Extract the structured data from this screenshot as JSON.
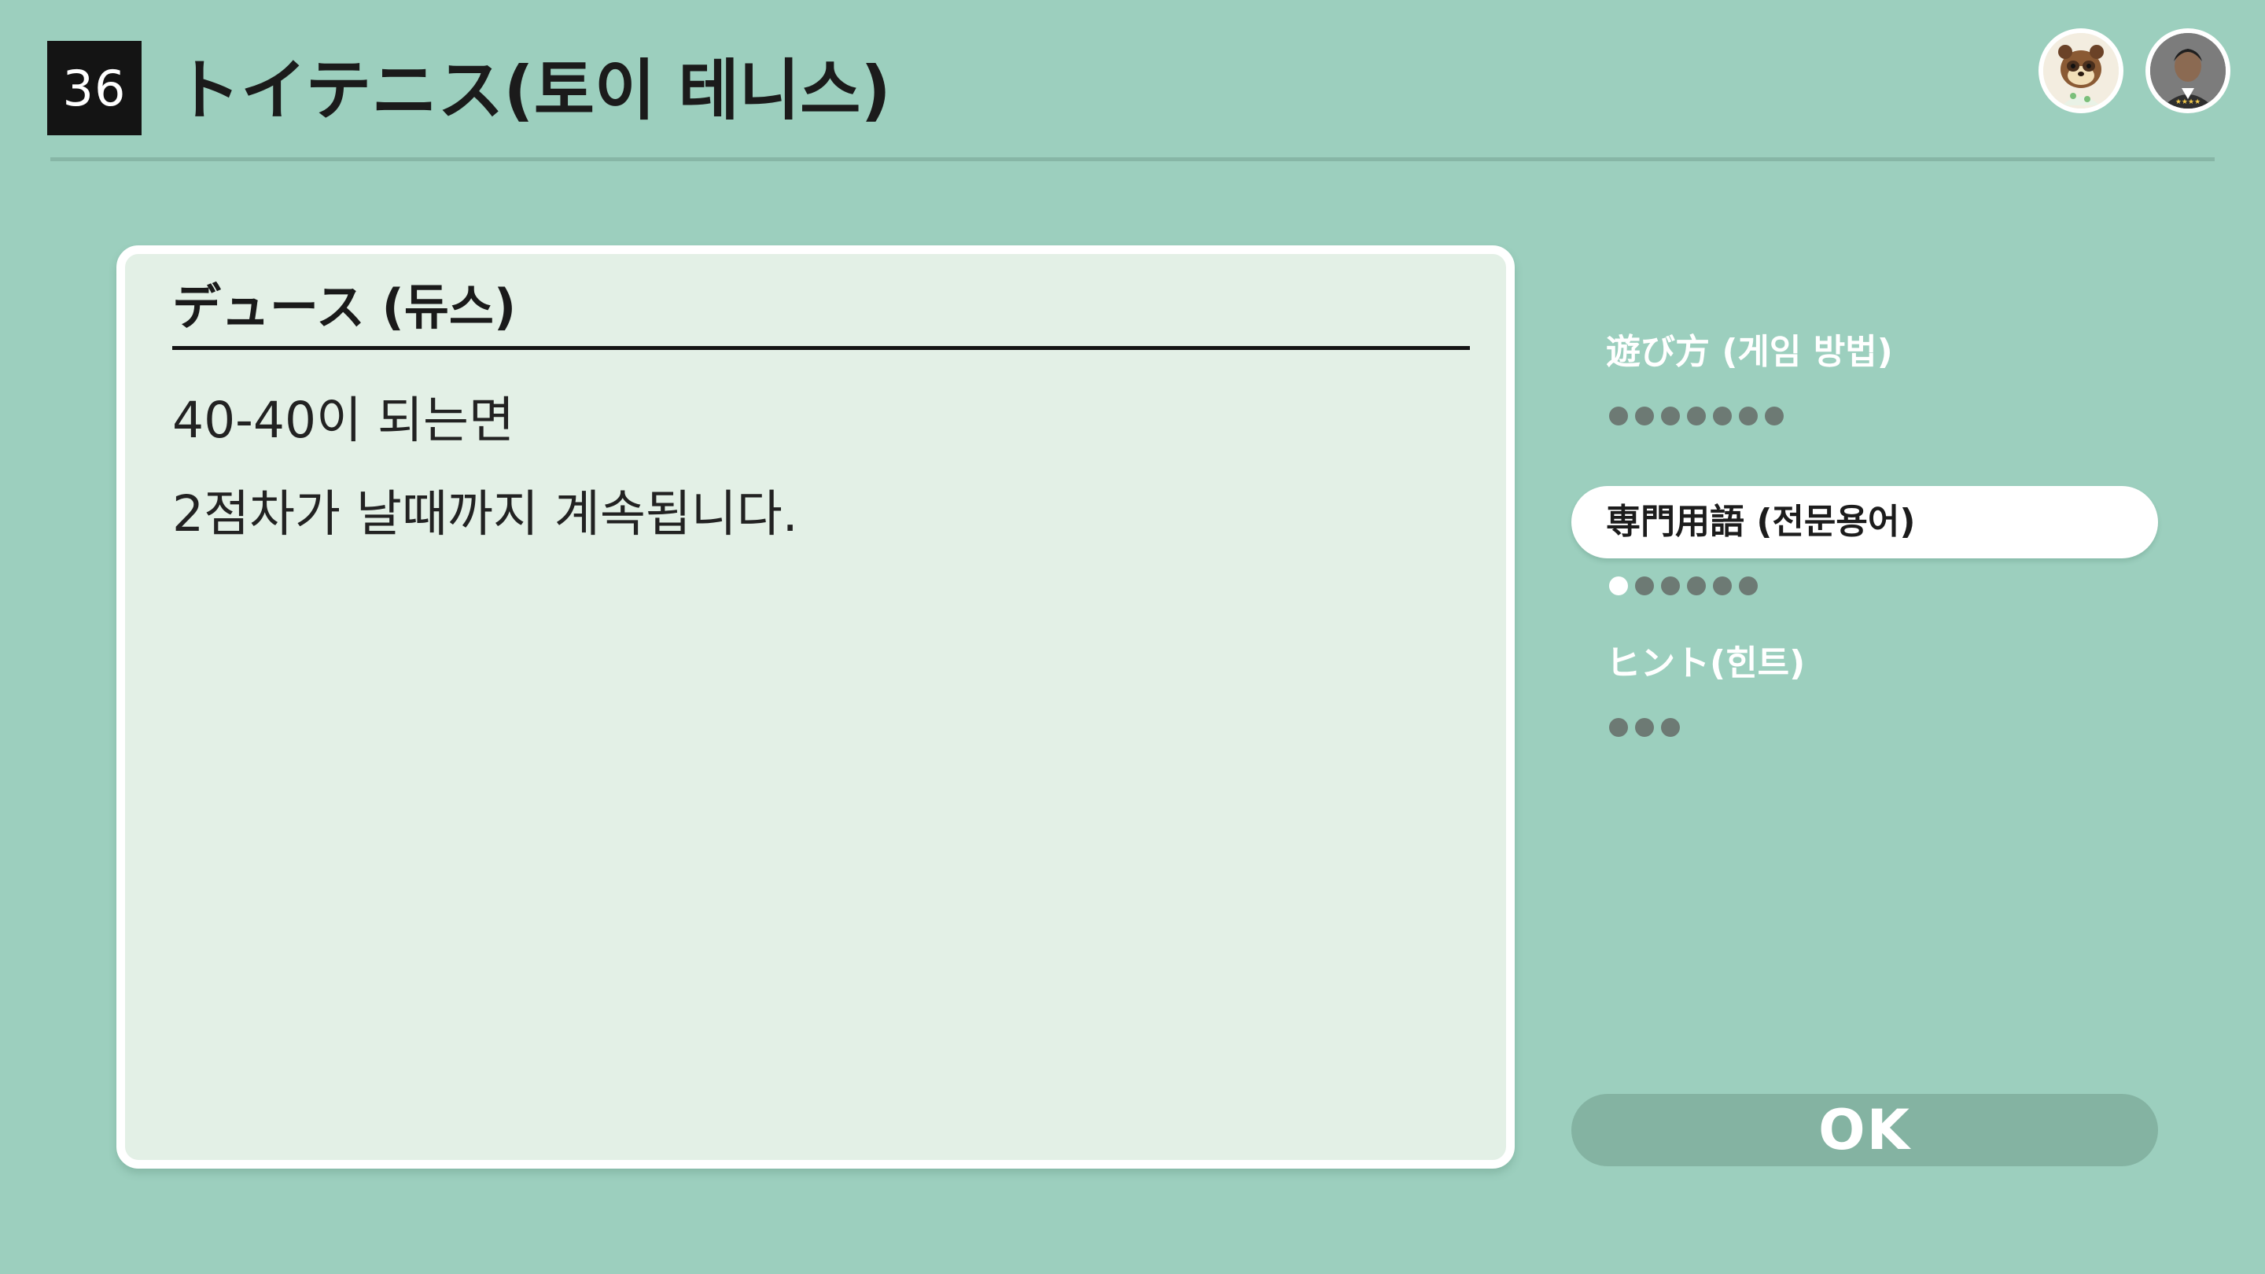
{
  "header": {
    "game_number": "36",
    "title": "トイテニス(토이 테니스)"
  },
  "card": {
    "title": "デュース (듀스)",
    "lines": [
      "40-40이 되는면",
      "2점차가 날때까지 계속됩니다."
    ]
  },
  "menu": {
    "items": [
      {
        "label": "遊び方 (게임 방법)",
        "dots": 7,
        "current_dot": null,
        "active": false
      },
      {
        "label": "専門用語 (전문용어)",
        "dots": 6,
        "current_dot": 1,
        "active": true
      },
      {
        "label": "ヒント(힌트)",
        "dots": 3,
        "current_dot": null,
        "active": false
      }
    ]
  },
  "ok_button": {
    "label": "OK"
  },
  "avatars": [
    {
      "icon": "tanuki-character-avatar-icon"
    },
    {
      "icon": "player-avatar-icon"
    }
  ],
  "colors": {
    "background": "#9ccfbe",
    "card": "#e3f0e6",
    "ok_button": "#84b3a2",
    "dot": "#6d7a74"
  }
}
